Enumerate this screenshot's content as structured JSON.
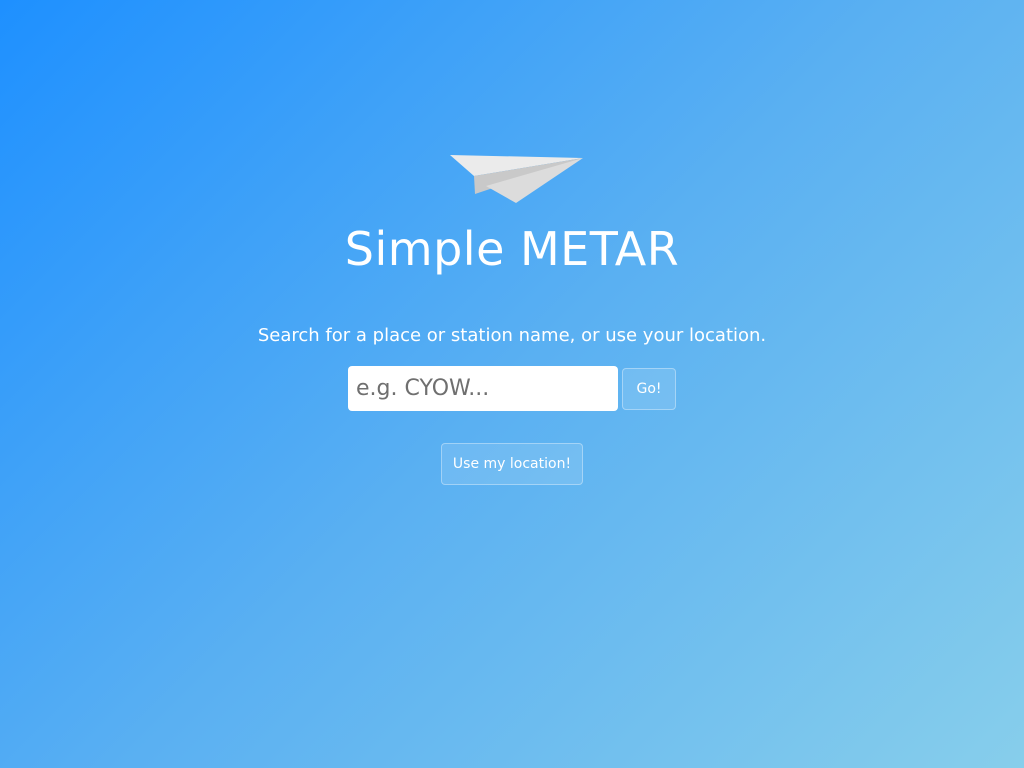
{
  "app": {
    "title": "Simple METAR",
    "subtitle": "Search for a place or station name, or use your location."
  },
  "search": {
    "value": "",
    "placeholder": "e.g. CYOW...",
    "go_label": "Go!"
  },
  "location": {
    "button_label": "Use my location!"
  },
  "icons": {
    "logo": "paper-plane-icon"
  },
  "colors": {
    "gradient_start": "#1e90ff",
    "gradient_end": "#87ceeb",
    "text": "#ffffff"
  }
}
